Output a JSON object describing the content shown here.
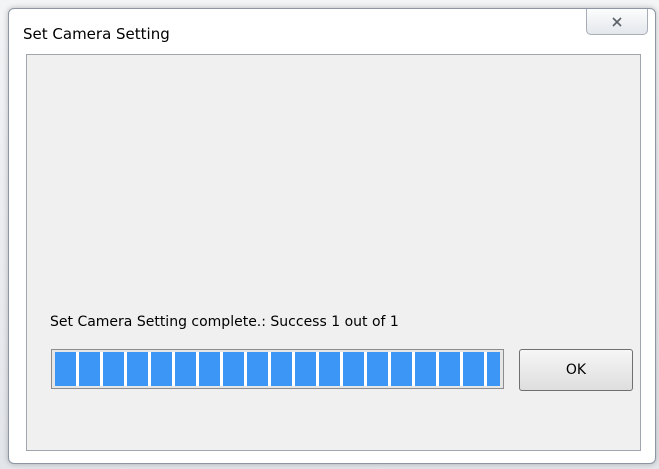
{
  "window": {
    "title": "Set Camera Setting",
    "close_icon": "close-icon"
  },
  "dialog": {
    "status_message": "Set Camera Setting complete.: Success 1 out of 1",
    "progress_fraction": 1.0,
    "ok_label": "OK"
  },
  "colors": {
    "progress_fill": "#3b96f5",
    "client_background": "#f0f0f0"
  }
}
